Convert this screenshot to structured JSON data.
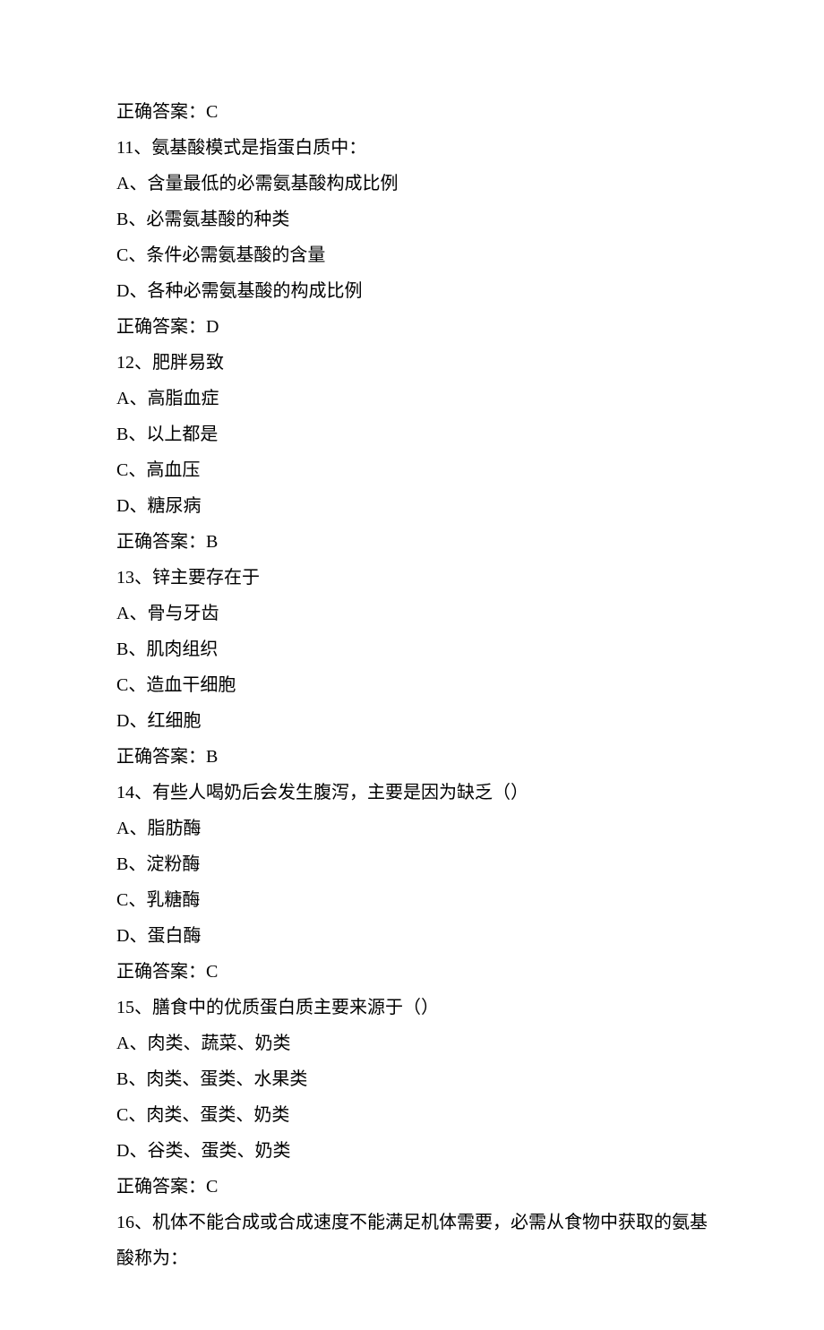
{
  "lines": [
    "正确答案：C",
    "11、氨基酸模式是指蛋白质中：",
    "A、含量最低的必需氨基酸构成比例",
    "B、必需氨基酸的种类",
    "C、条件必需氨基酸的含量",
    "D、各种必需氨基酸的构成比例",
    "正确答案：D",
    "12、肥胖易致",
    "A、高脂血症",
    "B、以上都是",
    "C、高血压",
    "D、糖尿病",
    "正确答案：B",
    "13、锌主要存在于",
    "A、骨与牙齿",
    "B、肌肉组织",
    "C、造血干细胞",
    "D、红细胞",
    "正确答案：B",
    "14、有些人喝奶后会发生腹泻，主要是因为缺乏（）",
    "A、脂肪酶",
    "B、淀粉酶",
    "C、乳糖酶",
    "D、蛋白酶",
    "正确答案：C",
    "15、膳食中的优质蛋白质主要来源于（）",
    "A、肉类、蔬菜、奶类",
    "B、肉类、蛋类、水果类",
    "C、肉类、蛋类、奶类",
    "D、谷类、蛋类、奶类",
    "正确答案：C",
    "16、机体不能合成或合成速度不能满足机体需要，必需从食物中获取的氨基酸称为："
  ]
}
